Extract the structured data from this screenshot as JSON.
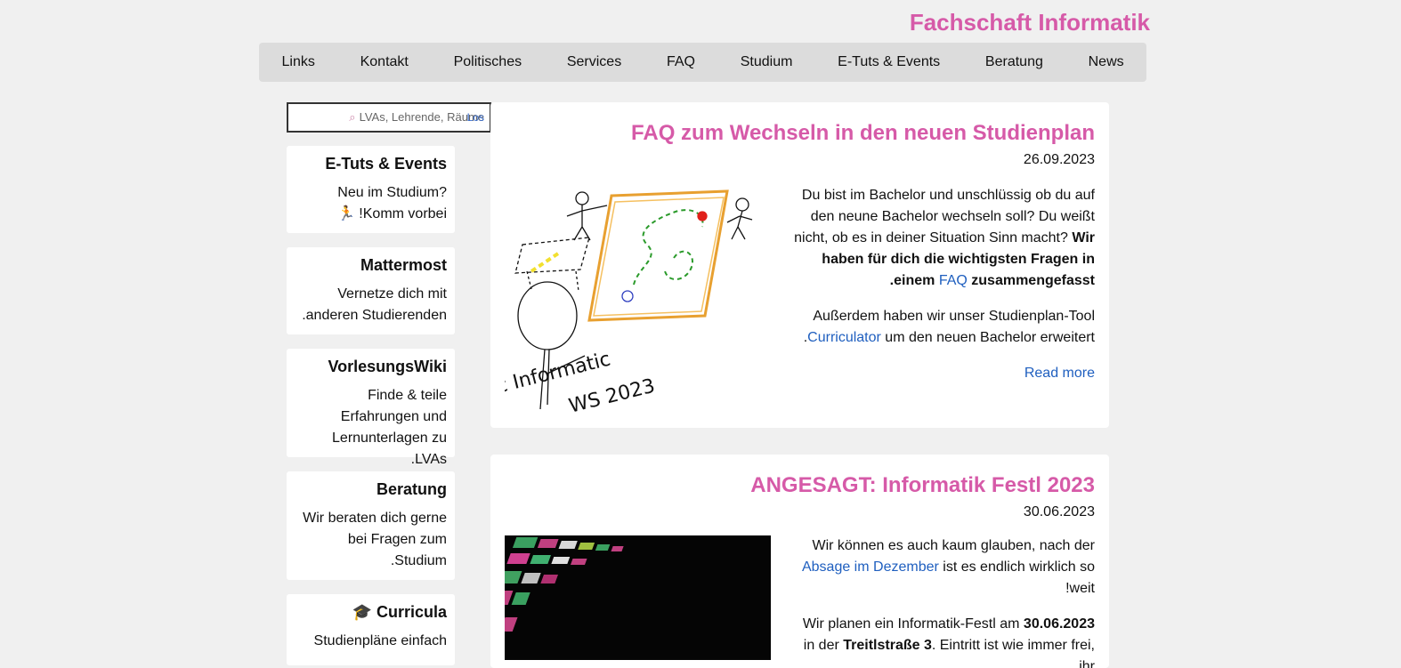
{
  "site": {
    "title": "Fachschaft Informatik"
  },
  "nav": [
    "News",
    "Beratung",
    "E-Tuts & Events",
    "Studium",
    "FAQ",
    "Services",
    "Politisches",
    "Kontakt",
    "Links"
  ],
  "search": {
    "placeholder": "LVAs, Lehrende, Räume",
    "go": "Los"
  },
  "sidebar": [
    {
      "title": "E-Tuts & Events",
      "text": "Neu im Studium? Komm vorbei! 🏃"
    },
    {
      "title": "Mattermost",
      "text": "Vernetze dich mit anderen Studierenden."
    },
    {
      "title": "VorlesungsWiki",
      "text": "Finde & teile Erfahrungen und Lernunterlagen zu LVAs."
    },
    {
      "title": "Beratung",
      "text": "Wir beraten dich gerne bei Fragen zum Studium."
    },
    {
      "title": "Curricula 🎓",
      "text": "Studienpläne einfach"
    }
  ],
  "articles": [
    {
      "title": "FAQ zum Wechseln in den neuen Studienplan",
      "date": "26.09.2023",
      "p1_plain": "Du bist im Bachelor und unschlüssig ob du auf den neune Bachelor wechseln soll? Du weißt nicht, ob es in deiner Situation Sinn macht?",
      "p1_bold": "Wir haben für dich die wichtigsten Fragen in einem",
      "p1_link": "FAQ",
      "p1_bold_end": "zusammengefasst.",
      "p2_text": "Außerdem haben wir unser Studienplan-Tool",
      "p2_link": "Curriculator",
      "p2_end": "um den neuen Bachelor erweitert.",
      "read_more": "Read more",
      "drawing_text": [
        "Bsc Informatic",
        "2023 WS"
      ]
    },
    {
      "title": "ANGESAGT: Informatik Festl 2023",
      "date": "30.06.2023",
      "p1_text": "Wir können es auch kaum glauben, nach der",
      "p1_link": "Absage im Dezember",
      "p1_end": "ist es endlich wirklich so weit!",
      "p2_text": "Wir planen ein Informatik-Festl am",
      "p2_bold": "30.06.2023",
      "p2_mid": "in der",
      "p2_bold2": "Treitlstraße 3",
      "p2_end": ". Eintritt ist wie immer frei, ihr"
    }
  ]
}
